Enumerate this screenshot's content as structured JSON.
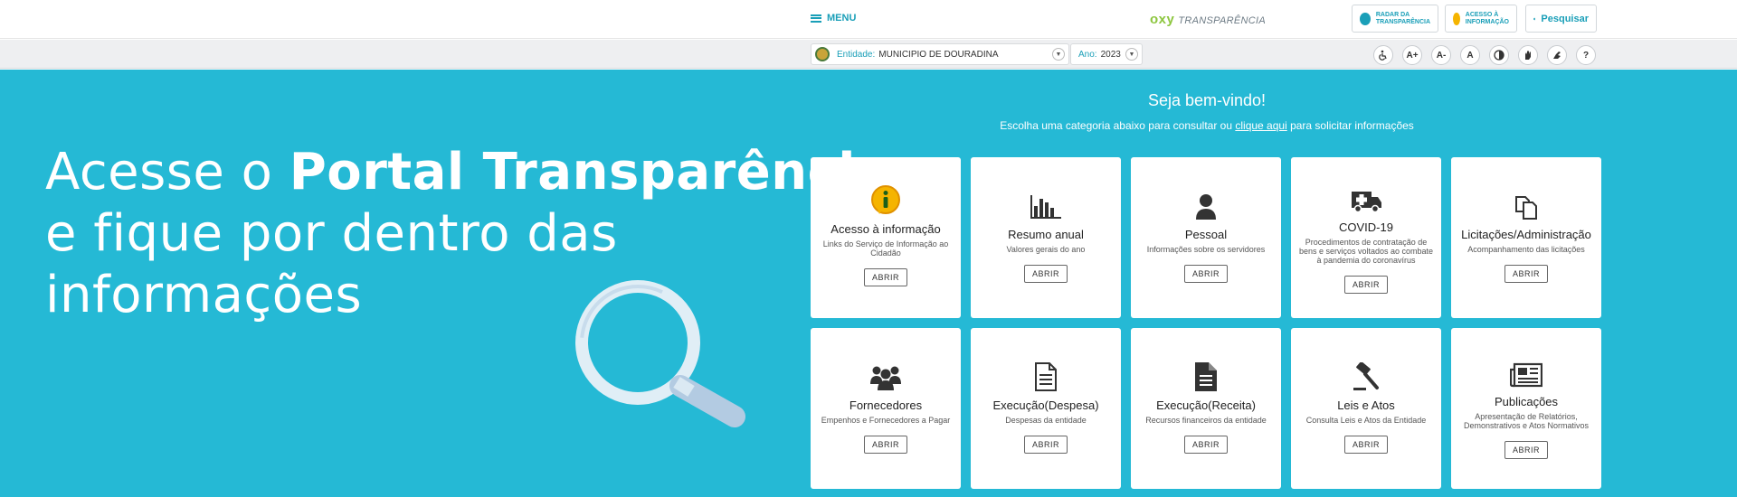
{
  "header": {
    "menu_label": "MENU",
    "logo_brand": "oxy",
    "logo_text": "TRANSPARÊNCIA",
    "radar_line1": "RADAR DA",
    "radar_line2": "TRANSPARÊNCIA",
    "acesso_line1": "ACESSO À",
    "acesso_line2": "INFORMAÇÃO",
    "search_label": "Pesquisar"
  },
  "filters": {
    "entity_label": "Entidade:",
    "entity_value": "MUNICIPIO DE DOURADINA",
    "year_label": "Ano:",
    "year_value": "2023"
  },
  "accessibility": {
    "font_increase": "A+",
    "font_decrease": "A-",
    "font_reset": "A",
    "help": "?"
  },
  "hero": {
    "line1_pre": "Acesse o ",
    "line1_bold": "Portal Transparência",
    "line2": "e fique por dentro das",
    "line3": "informações",
    "welcome": "Seja bem-vindo!",
    "sub_pre": "Escolha uma categoria abaixo para consultar ou ",
    "sub_link": "clique aqui",
    "sub_post": " para solicitar informações"
  },
  "cards": [
    {
      "title": "Acesso à informação",
      "desc": "Links do Serviço de Informação ao Cidadão",
      "button": "ABRIR",
      "icon": "info-icon"
    },
    {
      "title": "Resumo anual",
      "desc": "Valores gerais do ano",
      "button": "ABRIR",
      "icon": "bar-chart-icon"
    },
    {
      "title": "Pessoal",
      "desc": "Informações sobre os servidores",
      "button": "ABRIR",
      "icon": "person-icon"
    },
    {
      "title": "COVID-19",
      "desc": "Procedimentos de contratação de bens e serviços voltados ao combate à pandemia do coronavírus",
      "button": "ABRIR",
      "icon": "ambulance-icon"
    },
    {
      "title": "Licitações/Administração",
      "desc": "Acompanhamento das licitações",
      "button": "ABRIR",
      "icon": "copy-icon"
    },
    {
      "title": "Fornecedores",
      "desc": "Empenhos e Fornecedores a Pagar",
      "button": "ABRIR",
      "icon": "group-icon"
    },
    {
      "title": "Execução(Despesa)",
      "desc": "Despesas da entidade",
      "button": "ABRIR",
      "icon": "document-outline-icon"
    },
    {
      "title": "Execução(Receita)",
      "desc": "Recursos financeiros da entidade",
      "button": "ABRIR",
      "icon": "document-icon"
    },
    {
      "title": "Leis e Atos",
      "desc": "Consulta Leis e Atos da Entidade",
      "button": "ABRIR",
      "icon": "gavel-icon"
    },
    {
      "title": "Publicações",
      "desc": "Apresentação de Relatórios, Demonstrativos e Atos Normativos",
      "button": "ABRIR",
      "icon": "newspaper-icon"
    }
  ],
  "colors": {
    "hero_bg": "#25b9d5",
    "accent": "#1a9fb8",
    "logo_green": "#8dc63f"
  }
}
